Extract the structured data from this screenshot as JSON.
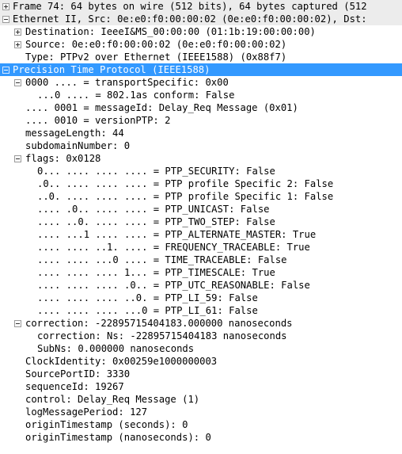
{
  "colors": {
    "selected_bg": "#3399ff",
    "selected_fg": "#ffffff",
    "header_bg": "#ececec"
  },
  "tree": {
    "frame": "Frame 74: 64 bytes on wire (512 bits), 64 bytes captured (512",
    "ethernet": "Ethernet II, Src: 0e:e0:f0:00:00:02 (0e:e0:f0:00:00:02), Dst:",
    "destination": "Destination: IeeeI&MS_00:00:00 (01:1b:19:00:00:00)",
    "source": "Source: 0e:e0:f0:00:00:02 (0e:e0:f0:00:00:02)",
    "type": "Type: PTPv2 over Ethernet (IEEE1588) (0x88f7)",
    "ptp": "Precision Time Protocol (IEEE1588)",
    "transport_specific": "0000 .... = transportSpecific: 0x00",
    "conform_8021as": "...0 .... = 802.1as conform: False",
    "message_id": ".... 0001 = messageId: Delay_Req Message (0x01)",
    "version_ptp": ".... 0010 = versionPTP: 2",
    "message_length": "messageLength: 44",
    "subdomain_number": "subdomainNumber: 0",
    "flags": "flags: 0x0128",
    "flag_items": [
      "0... .... .... .... = PTP_SECURITY: False",
      ".0.. .... .... .... = PTP profile Specific 2: False",
      "..0. .... .... .... = PTP profile Specific 1: False",
      ".... .0.. .... .... = PTP_UNICAST: False",
      ".... ..0. .... .... = PTP_TWO_STEP: False",
      ".... ...1 .... .... = PTP_ALTERNATE_MASTER: True",
      ".... .... ..1. .... = FREQUENCY_TRACEABLE: True",
      ".... .... ...0 .... = TIME_TRACEABLE: False",
      ".... .... .... 1... = PTP_TIMESCALE: True",
      ".... .... .... .0.. = PTP_UTC_REASONABLE: False",
      ".... .... .... ..0. = PTP_LI_59: False",
      ".... .... .... ...0 = PTP_LI_61: False"
    ],
    "correction": "correction: -22895715404183.000000 nanoseconds",
    "correction_ns": "correction: Ns: -22895715404183 nanoseconds",
    "subns": "SubNs: 0.000000 nanoseconds",
    "clock_identity": "ClockIdentity: 0x00259e1000000003",
    "source_port_id": "SourcePortID: 3330",
    "sequence_id": "sequenceId: 19267",
    "control": "control: Delay_Req Message (1)",
    "log_message_period": "logMessagePeriod: 127",
    "origin_ts_seconds": "originTimestamp (seconds): 0",
    "origin_ts_nanoseconds": "originTimestamp (nanoseconds): 0"
  }
}
